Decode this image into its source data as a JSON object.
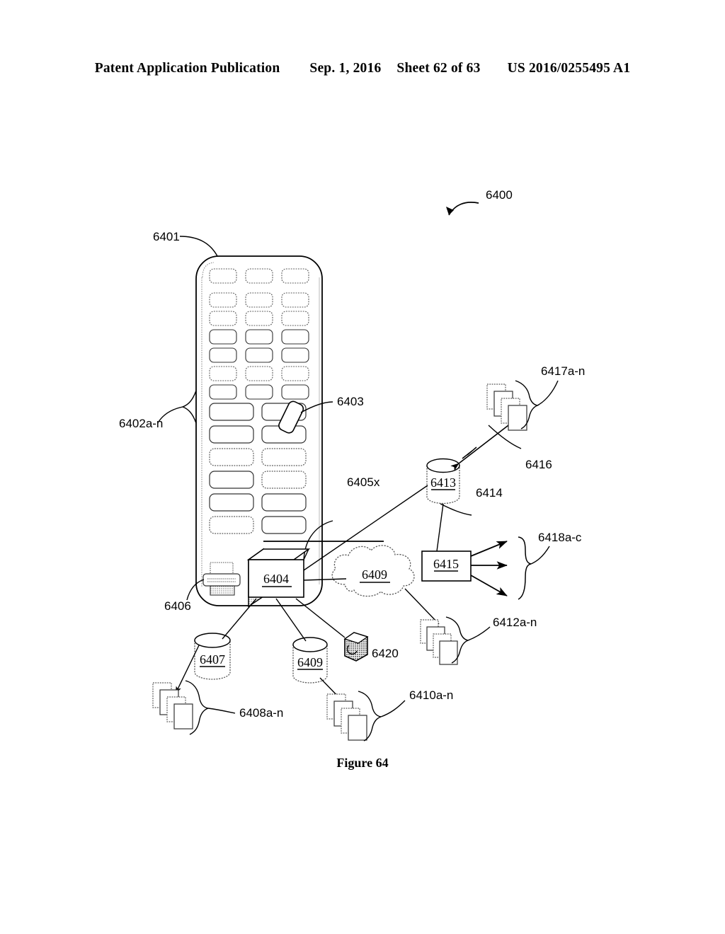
{
  "header": {
    "publication": "Patent Application Publication",
    "date": "Sep. 1, 2016",
    "sheet": "Sheet 62 of 63",
    "patent_number": "US 2016/0255495 A1"
  },
  "figure": {
    "caption": "Figure 64",
    "overall_ref": "6400"
  },
  "refs": {
    "cabinet": "6401",
    "slots_group": "6402a-n",
    "tilted_item": "6403",
    "server_box": "6404",
    "shelf_line": "6405x",
    "printer": "6406",
    "db_left": "6407",
    "docs_left": "6408a-n",
    "cloud": "6409",
    "db_mid": "6409",
    "docs_mid": "6410a-n",
    "docs_right": "6412a-n",
    "db_right": "6413",
    "link_6414": "6414",
    "proc_box": "6415",
    "link_6416": "6416",
    "docs_top_right": "6417a-n",
    "outputs": "6418a-c",
    "cube_icon": "6420"
  },
  "colors": {
    "ink": "#000000",
    "paper": "#ffffff",
    "shade": "#d9d9d9"
  }
}
